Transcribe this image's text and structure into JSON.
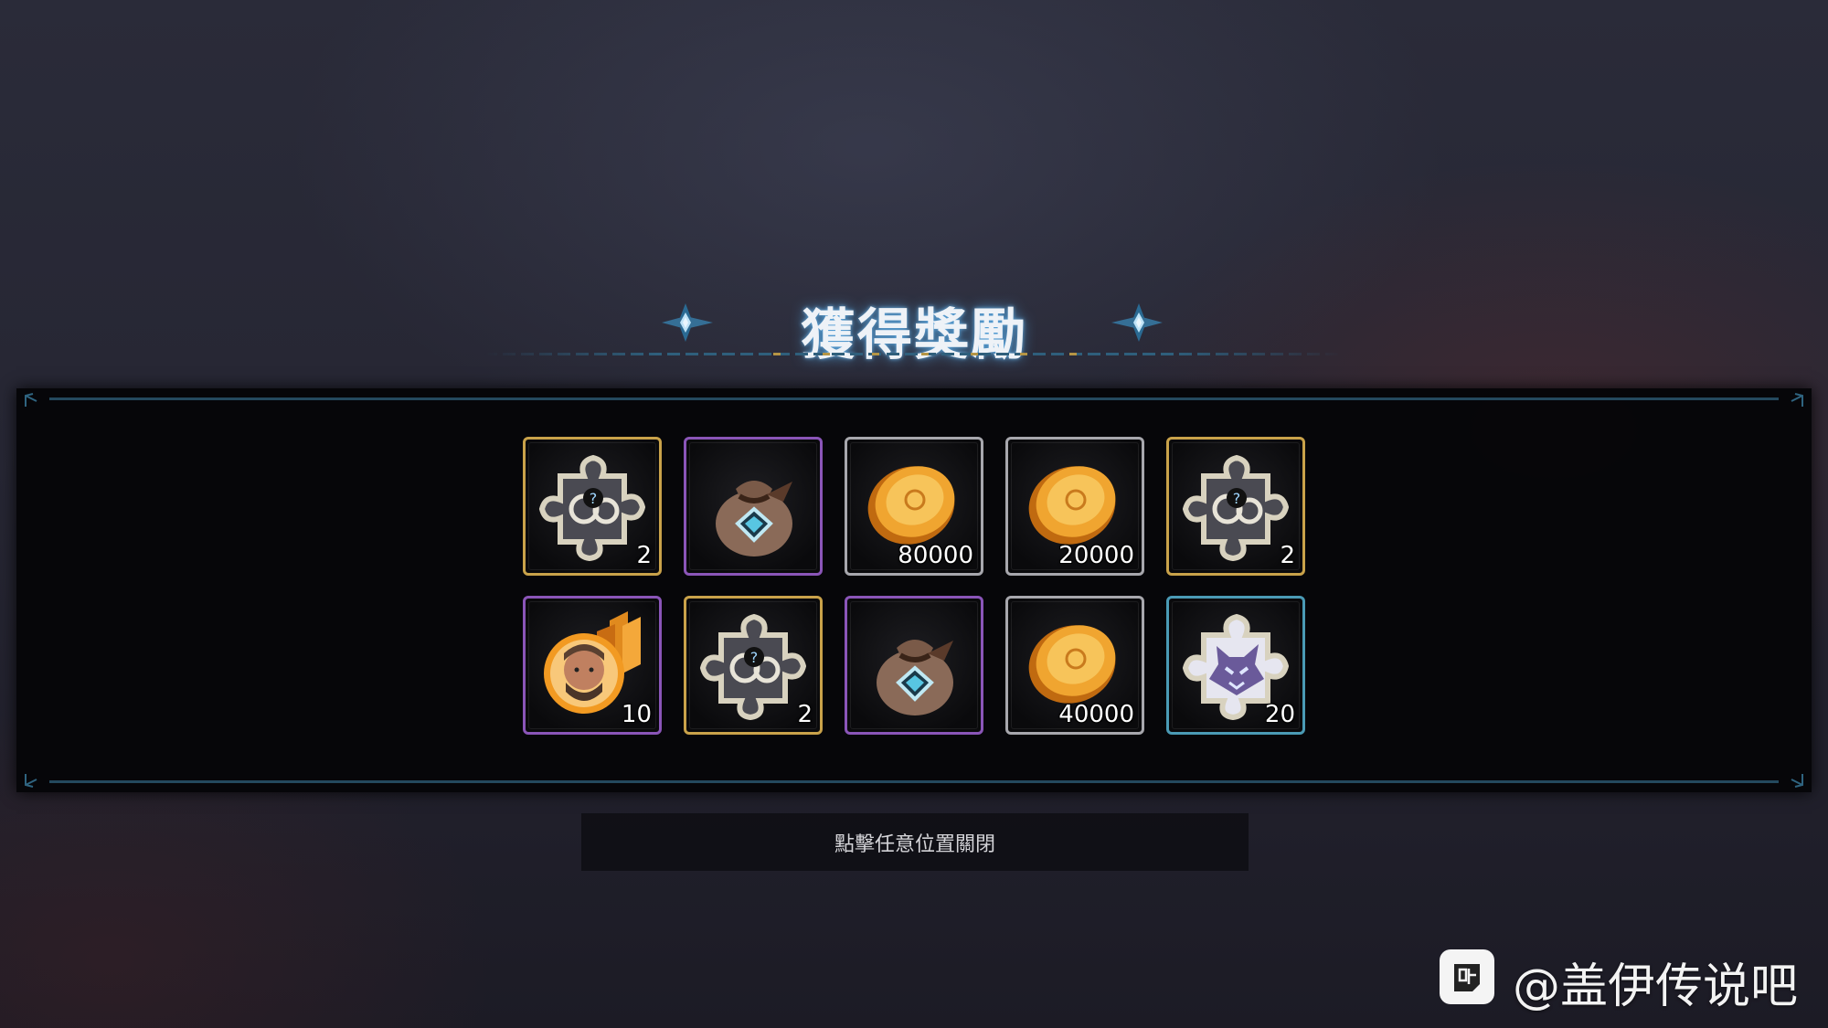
{
  "header": {
    "title": "獲得獎勵",
    "deco_icon": "compass-star-icon"
  },
  "rewards": [
    {
      "icon": "puzzle-fragment-icon",
      "quantity": "2",
      "rarity": "gold",
      "border_color": "#c9a24a"
    },
    {
      "icon": "gem-bag-icon",
      "quantity": "",
      "rarity": "purple",
      "border_color": "#8a55b8"
    },
    {
      "icon": "gold-coin-icon",
      "quantity": "80000",
      "rarity": "silver",
      "border_color": "#a7a7ad"
    },
    {
      "icon": "gold-coin-icon",
      "quantity": "20000",
      "rarity": "silver",
      "border_color": "#a7a7ad"
    },
    {
      "icon": "puzzle-fragment-icon",
      "quantity": "2",
      "rarity": "gold",
      "border_color": "#c9a24a"
    },
    {
      "icon": "hero-portrait-icon",
      "quantity": "10",
      "rarity": "purple",
      "border_color": "#8a55b8"
    },
    {
      "icon": "puzzle-fragment-icon",
      "quantity": "2",
      "rarity": "gold",
      "border_color": "#c9a24a"
    },
    {
      "icon": "gem-bag-icon",
      "quantity": "",
      "rarity": "purple",
      "border_color": "#8a55b8"
    },
    {
      "icon": "gold-coin-icon",
      "quantity": "40000",
      "rarity": "silver",
      "border_color": "#a7a7ad"
    },
    {
      "icon": "wolf-puzzle-fragment-icon",
      "quantity": "20",
      "rarity": "blue",
      "border_color": "#4a9ab5"
    }
  ],
  "footer": {
    "close_hint": "點擊任意位置關閉"
  },
  "watermark": {
    "logo_icon": "tieba-logo-icon",
    "text": "@盖伊传说吧"
  },
  "colors": {
    "accent_blue": "#3e8fbf",
    "gold": "#c9a24a",
    "panel_line": "#24495e"
  }
}
